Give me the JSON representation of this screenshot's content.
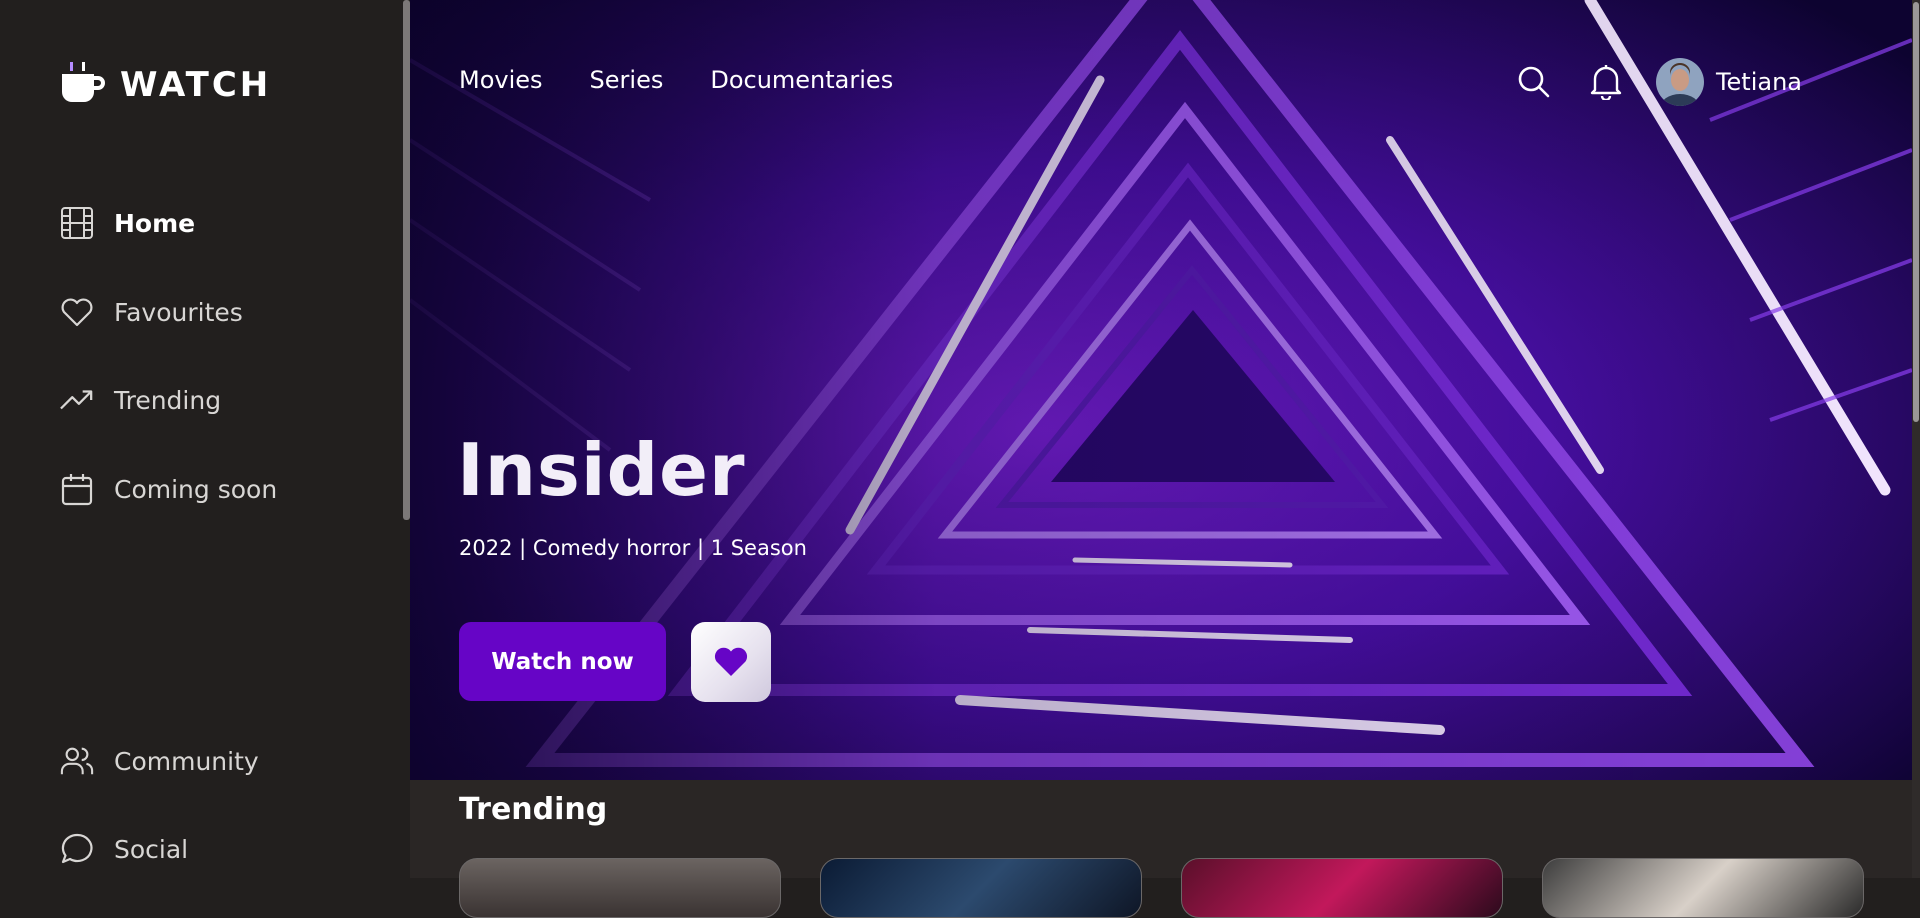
{
  "brand": {
    "name": "WATCH",
    "logo_icon": "cup-icon"
  },
  "sidebar": {
    "items": [
      {
        "label": "Home",
        "icon": "film-icon",
        "active": true
      },
      {
        "label": "Favourites",
        "icon": "heart-icon"
      },
      {
        "label": "Trending",
        "icon": "trending-icon"
      },
      {
        "label": "Coming soon",
        "icon": "calendar-icon"
      },
      {
        "label": "Community",
        "icon": "users-icon"
      },
      {
        "label": "Social",
        "icon": "chat-icon"
      }
    ]
  },
  "header": {
    "nav": [
      "Movies",
      "Series",
      "Documentaries"
    ],
    "search_icon": "search-icon",
    "bell_icon": "bell-icon",
    "user": {
      "name": "Tetiana"
    }
  },
  "hero": {
    "title": "Insider",
    "meta": "2022 | Comedy horror | 1 Season",
    "watch_label": "Watch now",
    "fav_icon": "heart-icon"
  },
  "trending": {
    "title": "Trending"
  },
  "colors": {
    "sidebar_bg": "#221f1e",
    "accent": "#6605c6",
    "hero_purple": "#8a2be2"
  }
}
